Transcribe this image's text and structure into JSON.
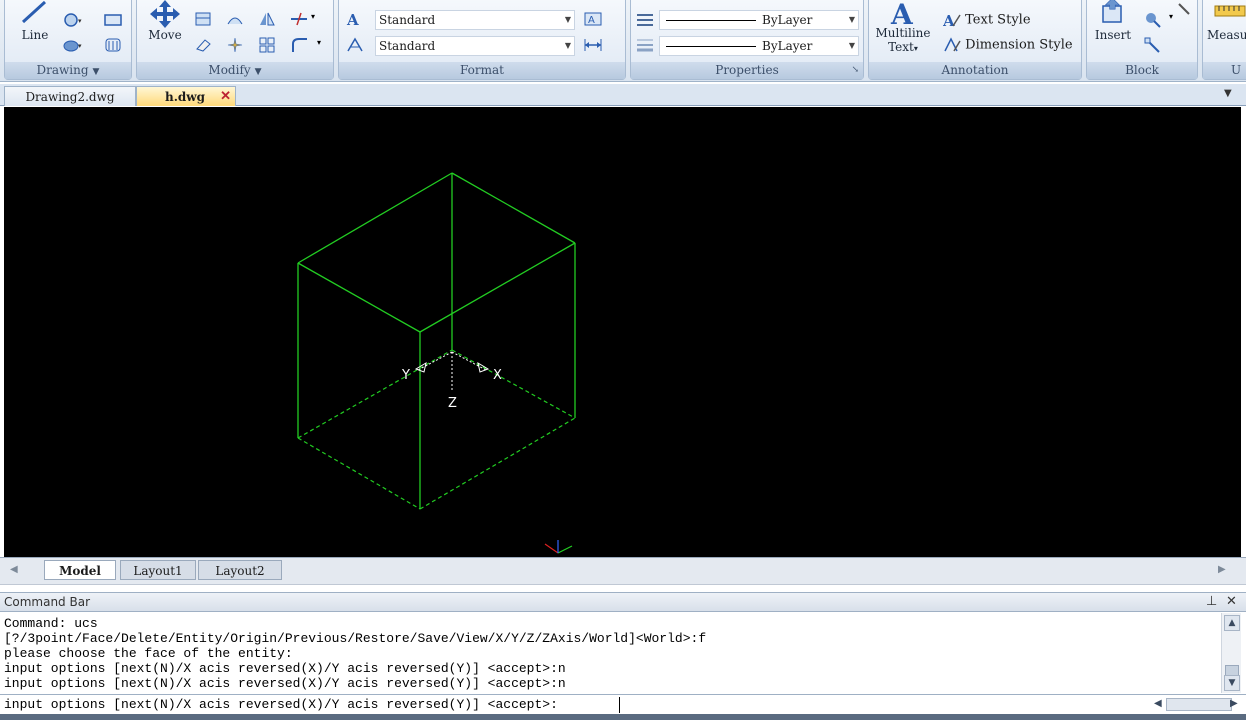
{
  "ribbon": {
    "drawing": {
      "line_label": "Line",
      "panel_label": "Drawing"
    },
    "modify": {
      "move_label": "Move",
      "panel_label": "Modify"
    },
    "format": {
      "combo1": "Standard",
      "combo2": "Standard",
      "panel_label": "Format"
    },
    "properties": {
      "linetype": "ByLayer",
      "lineweight": "ByLayer",
      "panel_label": "Properties"
    },
    "annotation": {
      "multiline_label_1": "Multiline",
      "multiline_label_2": "Text",
      "text_style": "Text Style",
      "dimension_style": "Dimension Style",
      "panel_label": "Annotation"
    },
    "block": {
      "insert_label": "Insert",
      "panel_label": "Block"
    },
    "utilities": {
      "measure_label": "Measu",
      "panel_label": "U"
    }
  },
  "doc_tabs": [
    {
      "label": "Drawing2.dwg"
    },
    {
      "label": "h.dwg"
    }
  ],
  "canvas": {
    "ucs_labels": {
      "x": "X",
      "y": "Y",
      "z": "Z"
    }
  },
  "layout_tabs": [
    {
      "label": "Model"
    },
    {
      "label": "Layout1"
    },
    {
      "label": "Layout2"
    }
  ],
  "command_bar": {
    "title": "Command Bar",
    "history": [
      "Command: ucs",
      "[?/3point/Face/Delete/Entity/Origin/Previous/Restore/Save/View/X/Y/Z/ZAxis/World]<World>:f",
      "please choose the face of the entity:",
      "input options [next(N)/X acis reversed(X)/Y acis reversed(Y)] <accept>:n",
      "input options [next(N)/X acis reversed(X)/Y acis reversed(Y)] <accept>:n"
    ],
    "prompt": "input options [next(N)/X acis reversed(X)/Y acis reversed(Y)] <accept>:"
  },
  "colors": {
    "geometry": "#22cc22",
    "canvas_bg": "#000000",
    "ribbon_bg": "#dfe8f3"
  },
  "icons": [
    "line-icon",
    "move-icon",
    "text-style-icon",
    "dimension-style-icon",
    "multiline-text-icon",
    "insert-icon",
    "close-icon",
    "pin-icon"
  ]
}
